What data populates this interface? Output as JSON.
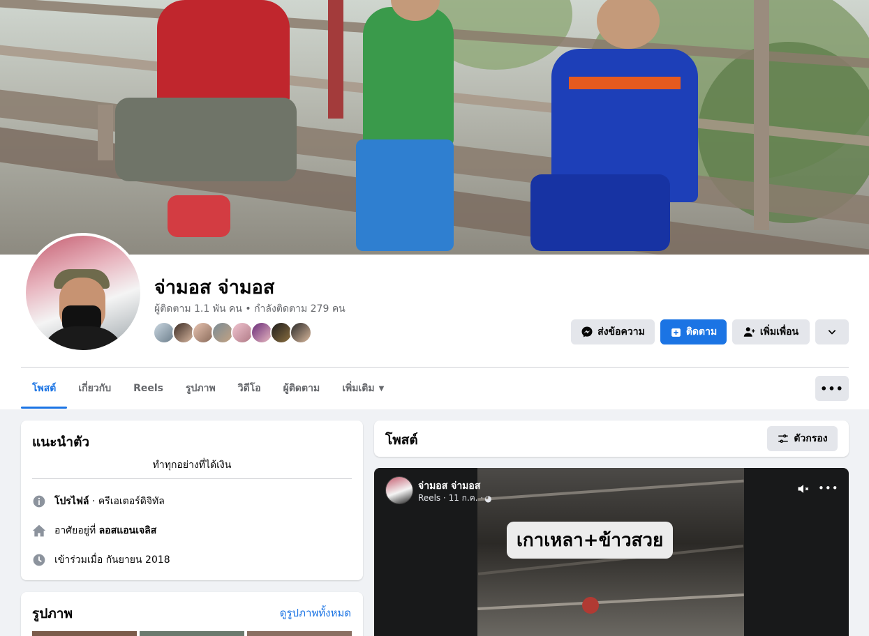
{
  "profile": {
    "name": "จ่ามอส จ่ามอส",
    "stats": "ผู้ติดตาม 1.1 พัน คน • กำลังติดตาม 279 คน"
  },
  "actions": {
    "message_label": "ส่งข้อความ",
    "follow_label": "ติดตาม",
    "add_friend_label": "เพิ่มเพื่อน"
  },
  "tabs": [
    {
      "label": "โพสต์",
      "active": true
    },
    {
      "label": "เกี่ยวกับ"
    },
    {
      "label": "Reels"
    },
    {
      "label": "รูปภาพ"
    },
    {
      "label": "วิดีโอ"
    },
    {
      "label": "ผู้ติดตาม"
    },
    {
      "label": "เพิ่มเติม"
    }
  ],
  "intro": {
    "title": "แนะนำตัว",
    "bio": "ทำทุกอย่างที่ได้เงิน",
    "profile_label": "โปรไฟล์",
    "profile_type": " · ครีเอเตอร์ดิจิทัล",
    "lives_prefix": "อาศัยอยู่ที่ ",
    "lives_city": "ลอสแอนเจลิส",
    "joined": "เข้าร่วมเมื่อ กันยายน 2018"
  },
  "photos": {
    "title": "รูปภาพ",
    "see_all": "ดูรูปภาพทั้งหมด"
  },
  "posts": {
    "title": "โพสต์",
    "filter_label": "ตัวกรอง"
  },
  "post": {
    "author": "จ่ามอส จ่ามอส",
    "meta": "Reels · 11 ก.ค. · ",
    "video_caption": "เกาเหลา+ข้าวสวย"
  },
  "colors": {
    "accent": "#1b74e4",
    "background": "#f0f2f5",
    "secondary_text": "#65676b"
  }
}
